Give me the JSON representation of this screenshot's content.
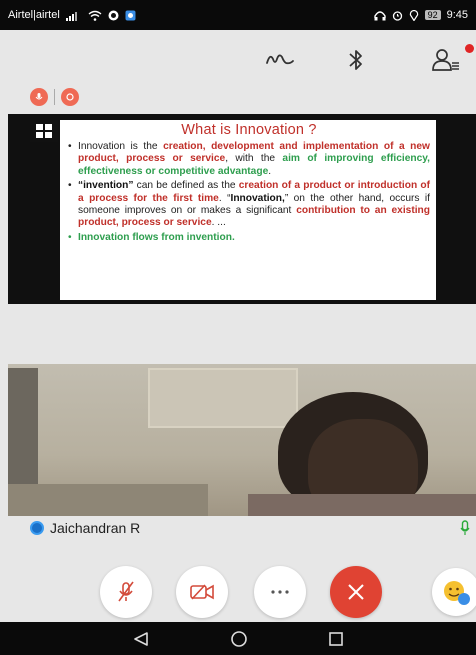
{
  "status_bar": {
    "carrier": "Airtel|airtel",
    "battery": "92",
    "time": "9:45"
  },
  "slide": {
    "title": "What is Innovation ?",
    "p1": {
      "a": "Innovation is the ",
      "b": "creation, development and implementation of a new product, process or service",
      "c": ", with the ",
      "d": "aim of improving efficiency, effectiveness or competitive advantage",
      "e": "."
    },
    "p2": {
      "a": "“invention”",
      "b": " can be defined as the ",
      "c": "creation of a product or introduction of a process for the first time",
      "d": ". “",
      "e": "Innovation,",
      "f": "” on the other hand, occurs if someone improves on or makes a significant ",
      "g": "contribution to an existing product, process or service",
      "h": ". ..."
    },
    "p3": "Innovation flows from invention."
  },
  "participant": {
    "name": "Jaichandran R"
  },
  "icons": {
    "whiteboard": "whiteboard-icon",
    "bluetooth": "bluetooth-icon",
    "participants": "participants-icon",
    "mute": "mic-off-icon",
    "camera": "camera-off-icon",
    "more": "more-icon",
    "end": "end-call-icon",
    "emoji": "emoji-icon"
  },
  "colors": {
    "end_call": "#e04333",
    "slide_red": "#c0302a",
    "slide_green": "#2e9e4e",
    "reaction": "#ef6a55"
  }
}
